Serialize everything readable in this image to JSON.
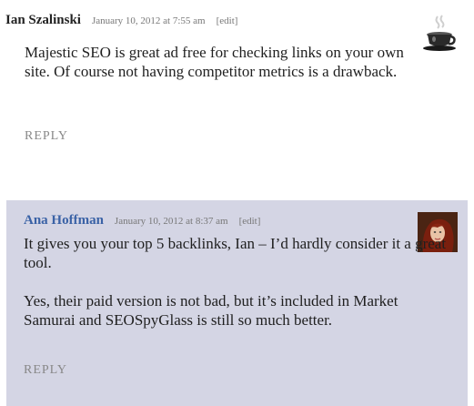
{
  "comments": [
    {
      "author": "Ian Szalinski",
      "date": "January 10, 2012 at 7:55 am",
      "edit_label": "[edit]",
      "avatar_icon": "coffee-cup-icon",
      "paragraphs": [
        "Majestic SEO is great ad free for checking links on your own site. Of course not having competitor metrics is a drawback."
      ],
      "reply_label": "REPLY"
    },
    {
      "author": "Ana Hoffman",
      "date": "January 10, 2012 at 8:37 am",
      "edit_label": "[edit]",
      "avatar_icon": "user-photo-avatar",
      "paragraphs": [
        "It gives you your top 5 backlinks, Ian – I’d hardly consider it a great tool.",
        "Yes, their paid version is not bad, but it’s included in Market Samurai and SEOSpyGlass is still so much better."
      ],
      "reply_label": "REPLY"
    }
  ],
  "colors": {
    "reply_bg": "#d4d5e4",
    "author_link": "#3a62a6"
  }
}
